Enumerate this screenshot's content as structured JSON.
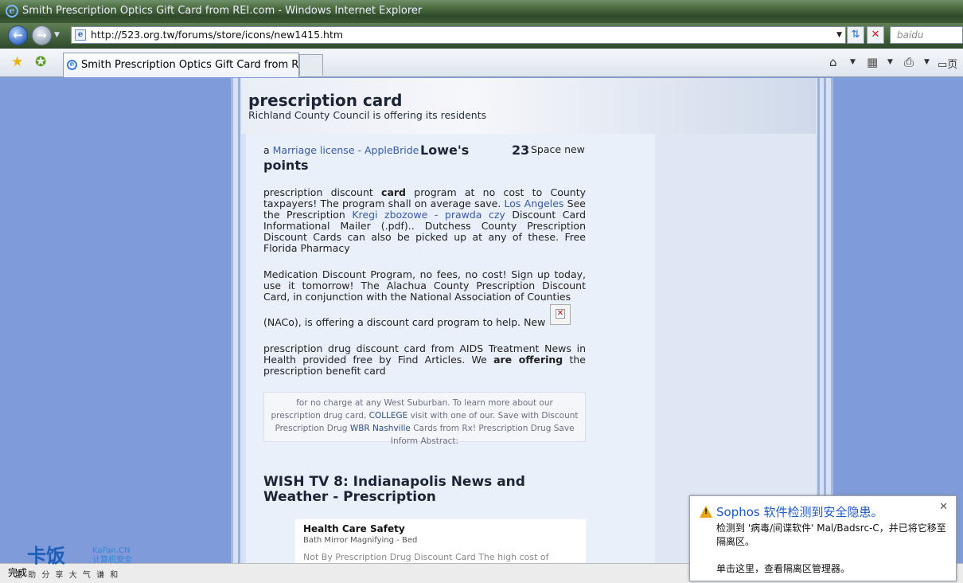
{
  "window": {
    "title": "Smith Prescription Optics Gift Card from REI.com - Windows Internet Explorer"
  },
  "address_bar": {
    "url": "http://523.org.tw/forums/store/icons/new1415.htm",
    "search_placeholder": "baidu"
  },
  "tabs": [
    {
      "label": "Smith Prescription Optics Gift Card from REI...."
    }
  ],
  "toolbar": {
    "page_label": "页"
  },
  "page": {
    "site_title": "prescription card",
    "site_subtitle": "Richland County Council is offering its residents",
    "topline_prefix": "a ",
    "topline_link": "Marriage license - AppleBride",
    "lowes": "Lowe's",
    "points": "points",
    "number": "23",
    "space_new": "Space new",
    "para1_a": "prescription discount ",
    "para1_bold": "card",
    "para1_b": " program at no cost to County taxpayers! The program shall on average save. ",
    "para1_link1": "Los Angeles",
    "para1_c": " See the Prescription ",
    "para1_link2": "Kregi zbozowe - prawda czy",
    "para1_d": " Discount Card Informational Mailer (.pdf).. Dutchess County Prescription Discount Cards can also be picked up at any of these. Free Florida Pharmacy",
    "para2": "Medication Discount Program, no fees, no cost! Sign up today, use it tomorrow! The Alachua County Prescription Discount Card, in conjunction with the National Association of Counties",
    "para3": "(NACo), is offering a discount card program to help. New",
    "para4_a": "prescription drug discount card from AIDS Treatment News in Health provided free by Find Articles. We ",
    "para4_bold": "are offering",
    "para4_b": " the prescription benefit card",
    "quote_a": "for no charge at any West Suburban. To learn more about our prescription drug card, ",
    "quote_link1": "COLLEGE",
    "quote_b": " visit with one of our. Save with Discount Prescription Drug ",
    "quote_link2": "WBR Nashville",
    "quote_c": " Cards from Rx! Prescription Drug Save Inform Abstract:",
    "heading2": "WISH TV 8: Indianapolis News and Weather - Prescription",
    "box_title": "Health Care Safety",
    "box_sub": "Bath Mirror Magnifying - Bed",
    "box_cut": "Not By Prescription Drug Discount Card The high cost of"
  },
  "status_bar": {
    "text": "完成",
    "watermark_text": "卡饭",
    "watermark_site": "KaFan.CN",
    "watermark_tag": "计算机安全",
    "watermark_slogan": "互 助 分 享     大 气 谦 和"
  },
  "sophos": {
    "title": "Sophos 软件检测到安全隐患。",
    "body": "检测到 '病毒/间谍软件' Mal/Badsrc-C，并已将它移至隔离区。",
    "action": "单击这里，查看隔离区管理器。"
  }
}
